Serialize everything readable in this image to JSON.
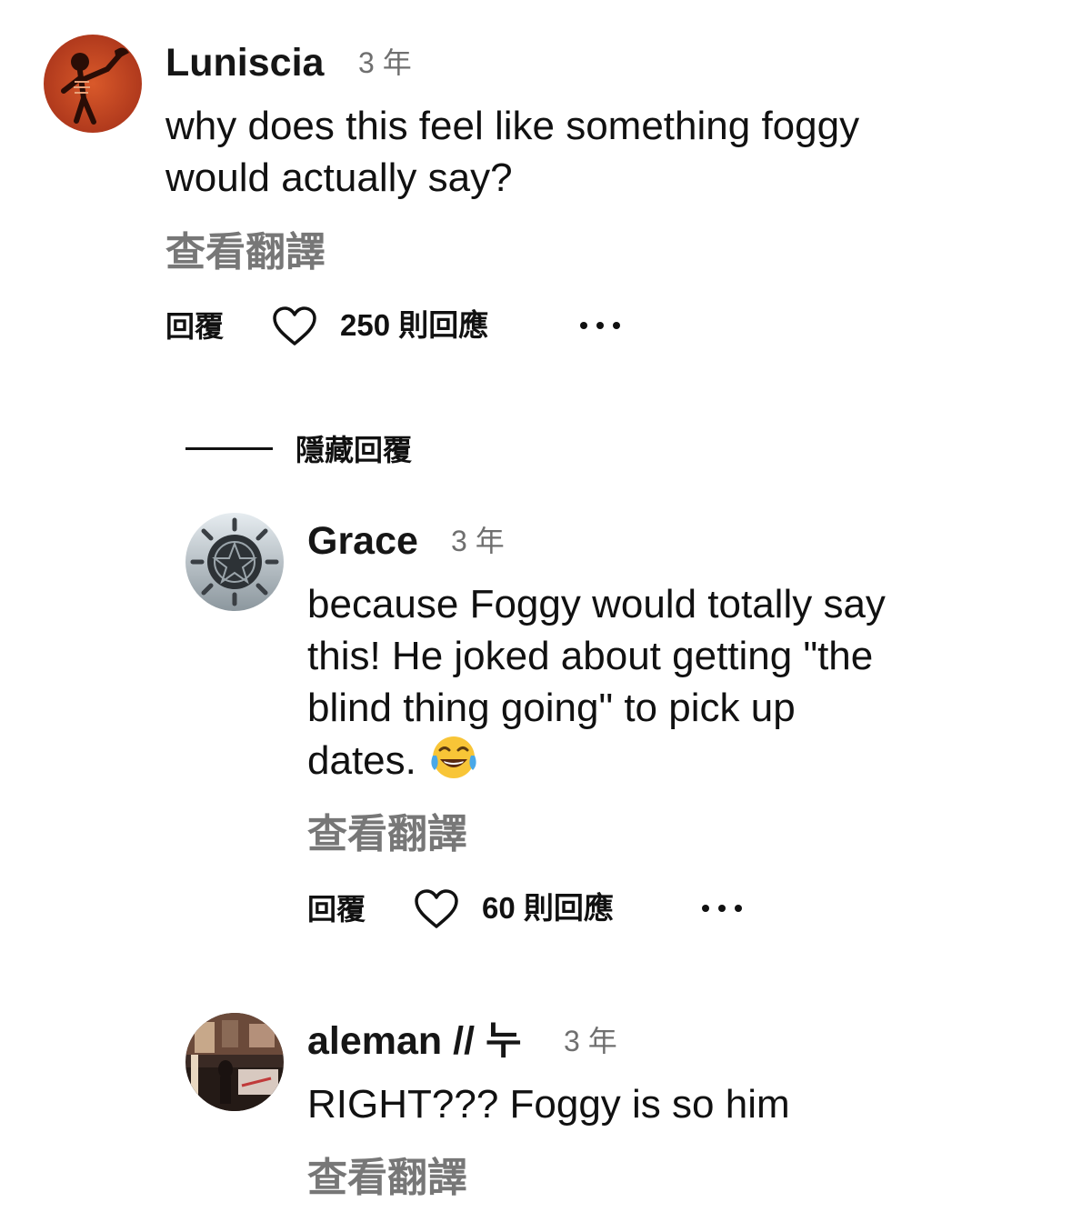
{
  "comments": [
    {
      "username": "Luniscia",
      "timestamp": "3 年",
      "lines": [
        "why does this feel like something foggy",
        "would actually say?"
      ],
      "translate_label": "查看翻譯",
      "reply_label": "回覆",
      "likes_label": "250 則回應",
      "avatar_icon": "skeleton-avatar"
    },
    {
      "username": "Grace",
      "timestamp": "3 年",
      "lines": [
        "because Foggy would totally say",
        "this! He joked about getting \"the",
        "blind thing going\" to pick up",
        "dates."
      ],
      "emoji": "😂",
      "translate_label": "查看翻譯",
      "reply_label": "回覆",
      "likes_label": "60 則回應",
      "avatar_icon": "pentagram-avatar"
    },
    {
      "username": "aleman // 누",
      "timestamp": "3 年",
      "lines": [
        "RIGHT??? Foggy is so him"
      ],
      "translate_label": "查看翻譯",
      "avatar_icon": "room-photo-avatar"
    }
  ],
  "hide_replies_label": "隱藏回覆",
  "icons": {
    "like": "heart-outline-icon",
    "more": "more-dots-icon"
  },
  "colors": {
    "text": "#111111",
    "muted": "#6f6f6f",
    "translate": "#777777"
  }
}
